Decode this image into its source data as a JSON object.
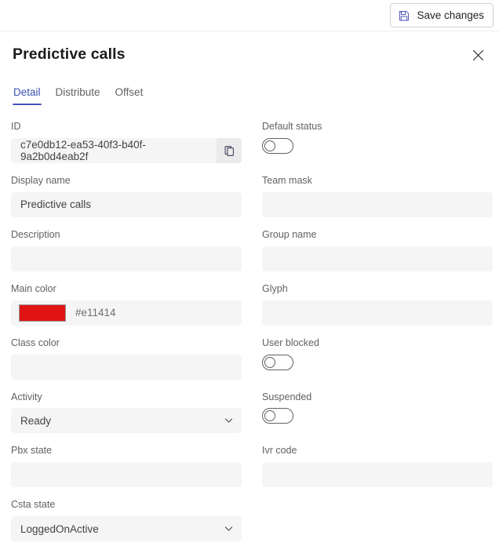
{
  "commandbar": {
    "save_label": "Save changes",
    "save_icon": "save-floppy-icon"
  },
  "header": {
    "title": "Predictive calls",
    "close_icon": "close-icon"
  },
  "tabs": [
    {
      "label": "Detail",
      "active": true
    },
    {
      "label": "Distribute",
      "active": false
    },
    {
      "label": "Offset",
      "active": false
    }
  ],
  "accent_color": "#4453b8",
  "form": {
    "left": {
      "id": {
        "label": "ID",
        "value": "c7e0db12-ea53-40f3-b40f-9a2b0d4eab2f",
        "copy_icon": "copy-icon"
      },
      "display_name": {
        "label": "Display name",
        "value": "Predictive calls"
      },
      "description": {
        "label": "Description",
        "value": ""
      },
      "main_color": {
        "label": "Main color",
        "value": "#e11414",
        "swatch": "#e11414"
      },
      "class_color": {
        "label": "Class color",
        "value": ""
      },
      "activity": {
        "label": "Activity",
        "value": "Ready"
      },
      "pbx_state": {
        "label": "Pbx state",
        "value": ""
      },
      "csta_state": {
        "label": "Csta state",
        "value": "LoggedOnActive"
      }
    },
    "right": {
      "default_status": {
        "label": "Default status",
        "checked": false
      },
      "team_mask": {
        "label": "Team mask",
        "value": ""
      },
      "group_name": {
        "label": "Group name",
        "value": ""
      },
      "glyph": {
        "label": "Glyph",
        "value": ""
      },
      "user_blocked": {
        "label": "User blocked",
        "checked": false
      },
      "suspended": {
        "label": "Suspended",
        "checked": false
      },
      "ivr_code": {
        "label": "Ivr code",
        "value": ""
      }
    }
  }
}
